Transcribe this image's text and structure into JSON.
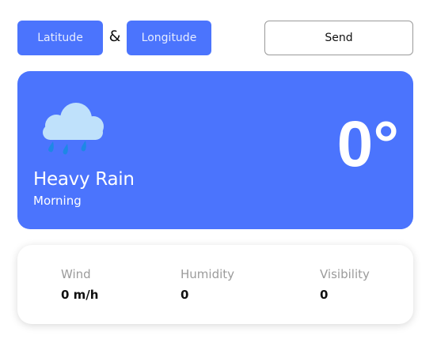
{
  "form": {
    "latitude_placeholder": "Latitude",
    "separator": "&",
    "longitude_placeholder": "Longitude",
    "send_label": "Send"
  },
  "weather": {
    "icon": "rain-cloud-icon",
    "condition": "Heavy Rain",
    "period": "Morning",
    "temperature": "0°"
  },
  "stats": {
    "wind_label": "Wind",
    "wind_value": "0 m/h",
    "humidity_label": "Humidity",
    "humidity_value": "0",
    "visibility_label": "Visibility",
    "visibility_value": "0"
  },
  "colors": {
    "accent": "#4b74fd",
    "cloud": "#bfe1fb",
    "raindrop": "#1e88e5",
    "muted_text": "#9b9b9b"
  }
}
